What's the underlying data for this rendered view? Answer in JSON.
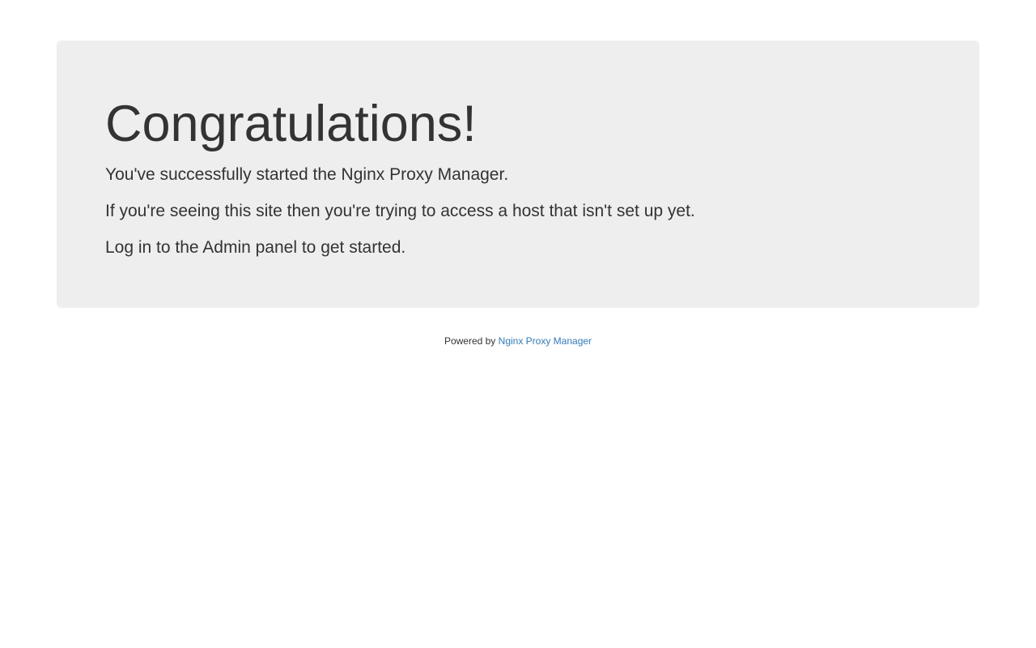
{
  "jumbotron": {
    "headline": "Congratulations!",
    "lines": [
      "You've successfully started the Nginx Proxy Manager.",
      "If you're seeing this site then you're trying to access a host that isn't set up yet.",
      "Log in to the Admin panel to get started."
    ]
  },
  "footer": {
    "prefix": "Powered by",
    "link_text": "Nginx Proxy Manager"
  },
  "colors": {
    "background": "#ffffff",
    "panel": "#eeeeee",
    "text": "#333333",
    "link": "#337ab7"
  }
}
